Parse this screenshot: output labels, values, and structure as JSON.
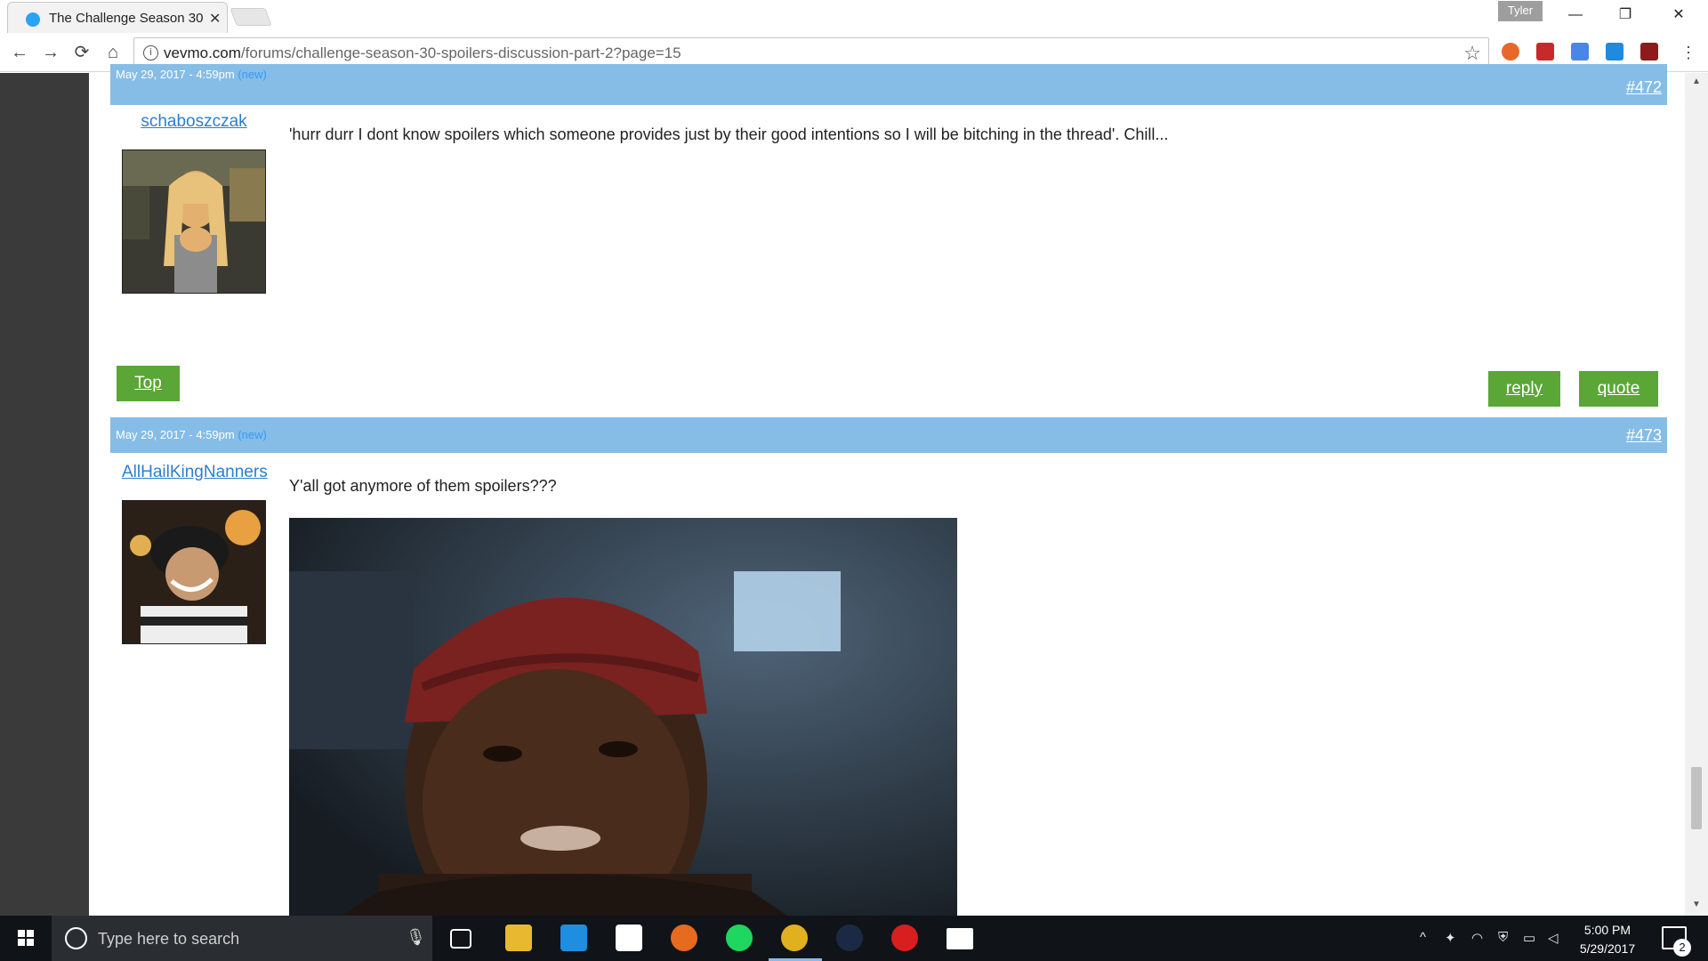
{
  "browser": {
    "tab_title": "The Challenge Season 30",
    "profile_name": "Tyler",
    "url_host": "vevmo.com",
    "url_path": "/forums/challenge-season-30-spoilers-discussion-part-2?page=15"
  },
  "posts": [
    {
      "date": "May 29, 2017 - 4:59pm",
      "new_label": "(new)",
      "number": "#472",
      "username": "schaboszczak",
      "text": "'hurr durr I dont know spoilers which someone provides just by their good intentions so I will be bitching in the thread'. Chill..."
    },
    {
      "date": "May 29, 2017 - 4:59pm",
      "new_label": "(new)",
      "number": "#473",
      "username": "AllHailKingNanners",
      "text": "Y'all got anymore of them spoilers???"
    }
  ],
  "buttons": {
    "top": "Top",
    "reply": "reply",
    "quote": "quote"
  },
  "taskbar": {
    "search_placeholder": "Type here to search",
    "time": "5:00 PM",
    "date": "5/29/2017",
    "notification_count": "2"
  },
  "colors": {
    "post_header": "#86bde6",
    "button_green": "#5aa636",
    "link_blue": "#2a7fd0",
    "taskbar": "#101418"
  },
  "icons": [
    "back-icon",
    "forward-icon",
    "reload-icon",
    "home-icon",
    "info-icon",
    "bookmark-star-icon",
    "menu-icon"
  ]
}
